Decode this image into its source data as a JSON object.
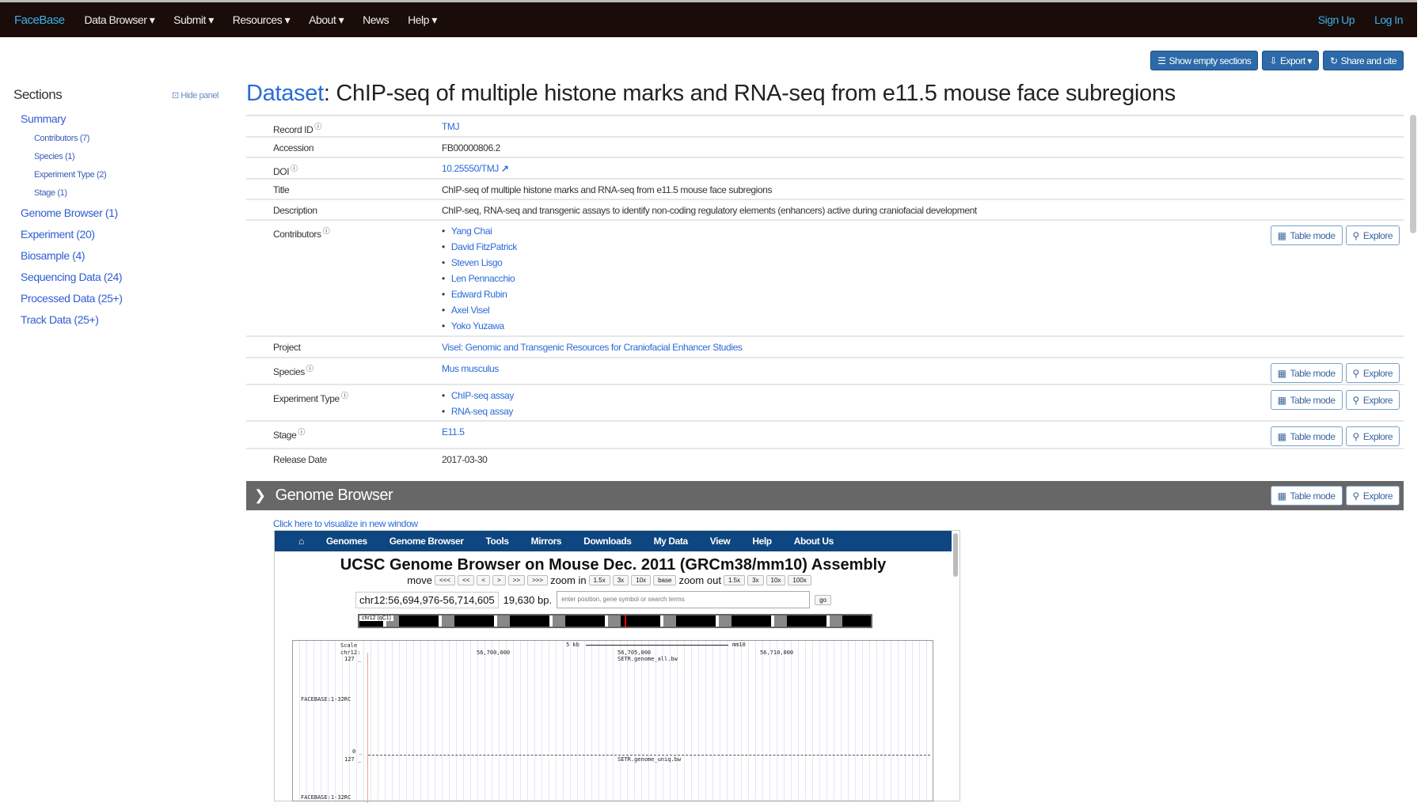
{
  "nav": {
    "brand": "FaceBase",
    "items": [
      "Data Browser ▾",
      "Submit ▾",
      "Resources ▾",
      "About ▾",
      "News",
      "Help ▾"
    ],
    "signup": "Sign Up",
    "login": "Log In"
  },
  "toolbar": {
    "show_empty": "Show empty sections",
    "export": "Export ▾",
    "share": "Share and cite"
  },
  "sidebar": {
    "title": "Sections",
    "hide": "Hide panel",
    "items": [
      {
        "label": "Summary",
        "sub": false
      },
      {
        "label": "Contributors (7)",
        "sub": true
      },
      {
        "label": "Species (1)",
        "sub": true
      },
      {
        "label": "Experiment Type (2)",
        "sub": true
      },
      {
        "label": "Stage (1)",
        "sub": true
      },
      {
        "label": "Genome Browser (1)",
        "sub": false
      },
      {
        "label": "Experiment (20)",
        "sub": false
      },
      {
        "label": "Biosample (4)",
        "sub": false
      },
      {
        "label": "Sequencing Data (24)",
        "sub": false
      },
      {
        "label": "Processed Data (25+)",
        "sub": false
      },
      {
        "label": "Track Data (25+)",
        "sub": false
      }
    ]
  },
  "page": {
    "title_prefix": "Dataset",
    "title": ": ChIP-seq of multiple histone marks and RNA-seq from e11.5 mouse face subregions"
  },
  "record": {
    "record_id": {
      "label": "Record ID",
      "value": "TMJ"
    },
    "accession": {
      "label": "Accession",
      "value": "FB00000806.2"
    },
    "doi": {
      "label": "DOI",
      "value": "10.25550/TMJ"
    },
    "title": {
      "label": "Title",
      "value": "ChIP-seq of multiple histone marks and RNA-seq from e11.5 mouse face subregions"
    },
    "description": {
      "label": "Description",
      "value": "ChIP-seq, RNA-seq and transgenic assays to identify non-coding regulatory elements (enhancers) active during craniofacial development"
    },
    "contributors": {
      "label": "Contributors",
      "values": [
        "Yang Chai",
        "David FitzPatrick",
        "Steven Lisgo",
        "Len Pennacchio",
        "Edward Rubin",
        "Axel Visel",
        "Yoko Yuzawa"
      ]
    },
    "project": {
      "label": "Project",
      "value": "Visel: Genomic and Transgenic Resources for Craniofacial Enhancer Studies"
    },
    "species": {
      "label": "Species",
      "value": "Mus musculus"
    },
    "experiment_type": {
      "label": "Experiment Type",
      "values": [
        "ChIP-seq assay",
        "RNA-seq assay"
      ]
    },
    "stage": {
      "label": "Stage",
      "value": "E11.5"
    },
    "release_date": {
      "label": "Release Date",
      "value": "2017-03-30"
    }
  },
  "actions": {
    "table_mode": "Table mode",
    "explore": "Explore"
  },
  "genome_browser": {
    "header": "Genome Browser",
    "link": "Click here to visualize in new window",
    "ucsc": {
      "nav": [
        "Genomes",
        "Genome Browser",
        "Tools",
        "Mirrors",
        "Downloads",
        "My Data",
        "View",
        "Help",
        "About Us"
      ],
      "title": "UCSC Genome Browser on Mouse Dec. 2011 (GRCm38/mm10) Assembly",
      "move": "move",
      "move_buttons": [
        "<<<",
        "<<",
        "<",
        ">",
        ">>",
        ">>>"
      ],
      "zoom_in": "zoom in",
      "zoom_in_buttons": [
        "1.5x",
        "3x",
        "10x",
        "base"
      ],
      "zoom_out": "zoom out",
      "zoom_out_buttons": [
        "1.5x",
        "3x",
        "10x",
        "100x"
      ],
      "position": "chr12:56,694,976-56,714,605",
      "size": "19,630 bp.",
      "search_placeholder": "enter position, gene symbol or search terms",
      "go": "go",
      "ideogram_label": "chr12 (qC1)",
      "scale_label": "Scale",
      "scale_bar": "5 kb",
      "assembly": "mm10",
      "chrom": "chr12:",
      "ticks": [
        "56,700,000",
        "56,705,000",
        "56,710,000"
      ],
      "track1": "SETR.genome_all.bw",
      "track2": "SETR.genome_uniq.bw",
      "track_label": "FACEBASE:1-32RC",
      "y_top": "127 _",
      "y_zero": "0 _"
    }
  }
}
